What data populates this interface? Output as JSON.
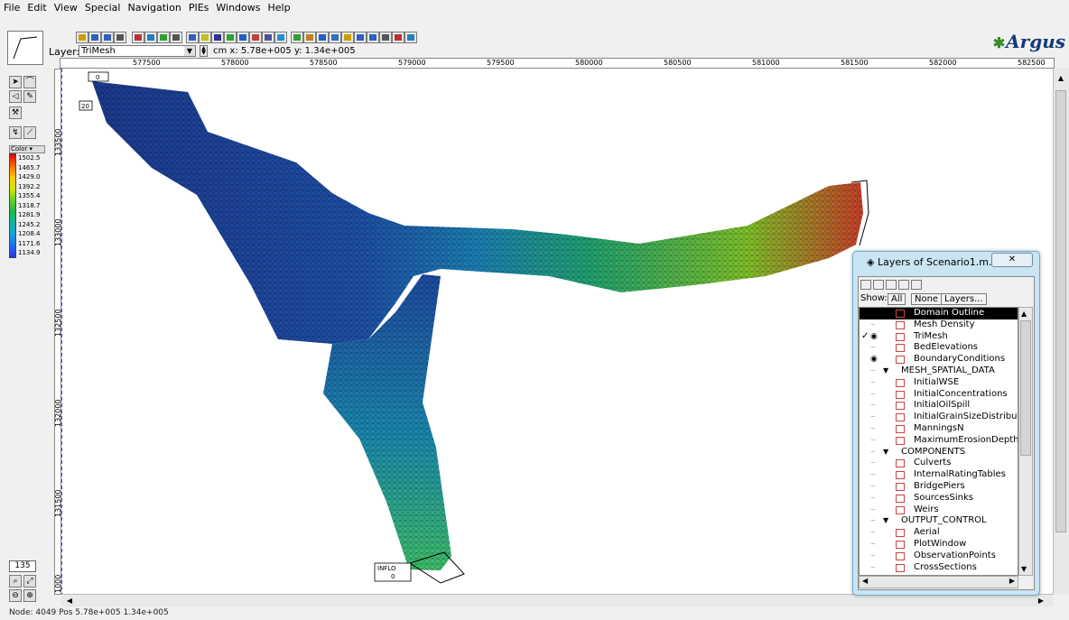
{
  "menu": [
    "File",
    "Edit",
    "View",
    "Special",
    "Navigation",
    "PIEs",
    "Windows",
    "Help"
  ],
  "toolbar": {
    "layer_label": "Layer:",
    "layer_value": "TriMesh",
    "coord_readout": "cm x: 5.78e+005 y: 1.34e+005",
    "brand": "Argus"
  },
  "ruler": {
    "x_ticks": [
      "577500",
      "578000",
      "578500",
      "579000",
      "579500",
      "580000",
      "580500",
      "581000",
      "581500",
      "582000",
      "582500"
    ],
    "y_ticks": [
      "133500",
      "133000",
      "132500",
      "132000",
      "131500",
      "1000"
    ]
  },
  "colorbar": {
    "title": "Color",
    "values": [
      "1502.5",
      "1465.7",
      "1429.0",
      "1392.2",
      "1355.4",
      "1318.7",
      "1281.9",
      "1245.2",
      "1208.4",
      "1171.6",
      "1134.9"
    ]
  },
  "canvas": {
    "boundary_labels": [
      "0",
      "20",
      "INFLO",
      "0"
    ],
    "colors": {
      "low": "#1c3a8e",
      "mid": "#22a36e",
      "high": "#c8402a"
    }
  },
  "zoom": "135",
  "layers_window": {
    "title": "Layers of Scenario1.m...",
    "show_label": "Show:",
    "btn_all": "All",
    "btn_none": "None",
    "btn_layers": "Layers...",
    "items": [
      {
        "name": "Domain Outline",
        "visible": true,
        "selected": true,
        "group": false,
        "checked": false
      },
      {
        "name": "Mesh Density",
        "visible": false,
        "selected": false,
        "group": false,
        "checked": false
      },
      {
        "name": "TriMesh",
        "visible": true,
        "selected": false,
        "group": false,
        "checked": true
      },
      {
        "name": "BedElevations",
        "visible": false,
        "selected": false,
        "group": false,
        "checked": false
      },
      {
        "name": "BoundaryConditions",
        "visible": true,
        "selected": false,
        "group": false,
        "checked": false
      },
      {
        "name": "MESH_SPATIAL_DATA",
        "visible": false,
        "selected": false,
        "group": true,
        "checked": false
      },
      {
        "name": "InitialWSE",
        "visible": false,
        "selected": false,
        "group": false,
        "checked": false
      },
      {
        "name": "InitialConcentrations",
        "visible": false,
        "selected": false,
        "group": false,
        "checked": false
      },
      {
        "name": "InitialOilSpill",
        "visible": false,
        "selected": false,
        "group": false,
        "checked": false
      },
      {
        "name": "InitialGrainSizeDistributio",
        "visible": false,
        "selected": false,
        "group": false,
        "checked": false
      },
      {
        "name": "ManningsN",
        "visible": false,
        "selected": false,
        "group": false,
        "checked": false
      },
      {
        "name": "MaximumErosionDepth",
        "visible": false,
        "selected": false,
        "group": false,
        "checked": false
      },
      {
        "name": "COMPONENTS",
        "visible": false,
        "selected": false,
        "group": true,
        "checked": false
      },
      {
        "name": "Culverts",
        "visible": false,
        "selected": false,
        "group": false,
        "checked": false
      },
      {
        "name": "InternalRatingTables",
        "visible": false,
        "selected": false,
        "group": false,
        "checked": false
      },
      {
        "name": "BridgePiers",
        "visible": false,
        "selected": false,
        "group": false,
        "checked": false
      },
      {
        "name": "SourcesSinks",
        "visible": false,
        "selected": false,
        "group": false,
        "checked": false
      },
      {
        "name": "Weirs",
        "visible": false,
        "selected": false,
        "group": false,
        "checked": false
      },
      {
        "name": "OUTPUT_CONTROL",
        "visible": false,
        "selected": false,
        "group": true,
        "checked": false
      },
      {
        "name": "Aerial",
        "visible": false,
        "selected": false,
        "group": false,
        "checked": false
      },
      {
        "name": "PlotWindow",
        "visible": false,
        "selected": false,
        "group": false,
        "checked": false
      },
      {
        "name": "ObservationPoints",
        "visible": false,
        "selected": false,
        "group": false,
        "checked": false
      },
      {
        "name": "CrossSections",
        "visible": false,
        "selected": false,
        "group": false,
        "checked": false
      }
    ]
  },
  "status": "Node: 4049   Pos 5.78e+005 1.34e+005"
}
